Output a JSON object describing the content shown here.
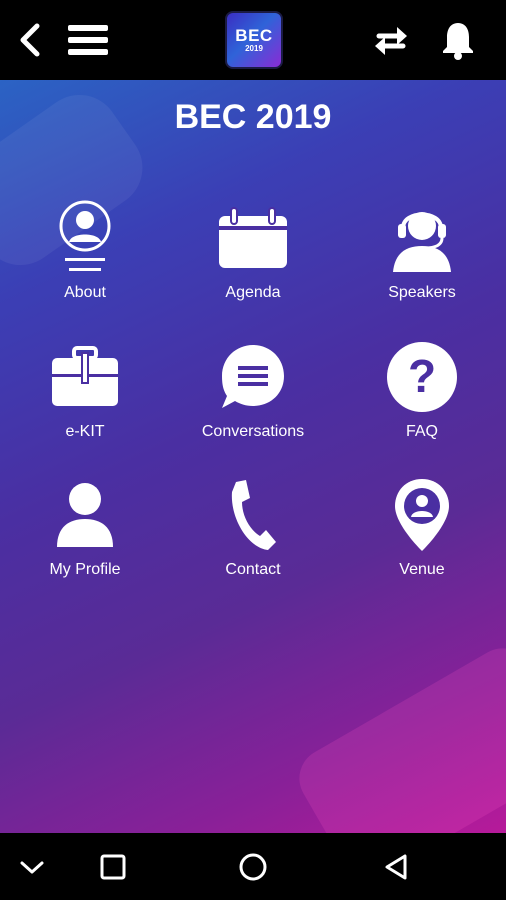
{
  "header": {
    "logo_line1": "BEC",
    "logo_line2": "2019",
    "icons": [
      "back-arrow-icon",
      "menu-icon",
      "sync-icon",
      "bell-icon"
    ]
  },
  "main": {
    "title": "BEC 2019",
    "tiles": [
      {
        "label": "About",
        "icon": "person-card-icon"
      },
      {
        "label": "Agenda",
        "icon": "calendar-icon"
      },
      {
        "label": "Speakers",
        "icon": "headset-icon"
      },
      {
        "label": "e-KIT",
        "icon": "briefcase-icon"
      },
      {
        "label": "Conversations",
        "icon": "chat-icon"
      },
      {
        "label": "FAQ",
        "icon": "question-icon"
      },
      {
        "label": "My Profile",
        "icon": "user-icon"
      },
      {
        "label": "Contact",
        "icon": "phone-icon"
      },
      {
        "label": "Venue",
        "icon": "location-pin-icon"
      }
    ]
  },
  "navbar": {
    "icons": [
      "chevron-down-icon",
      "square-icon",
      "circle-home-icon",
      "triangle-back-icon"
    ]
  }
}
